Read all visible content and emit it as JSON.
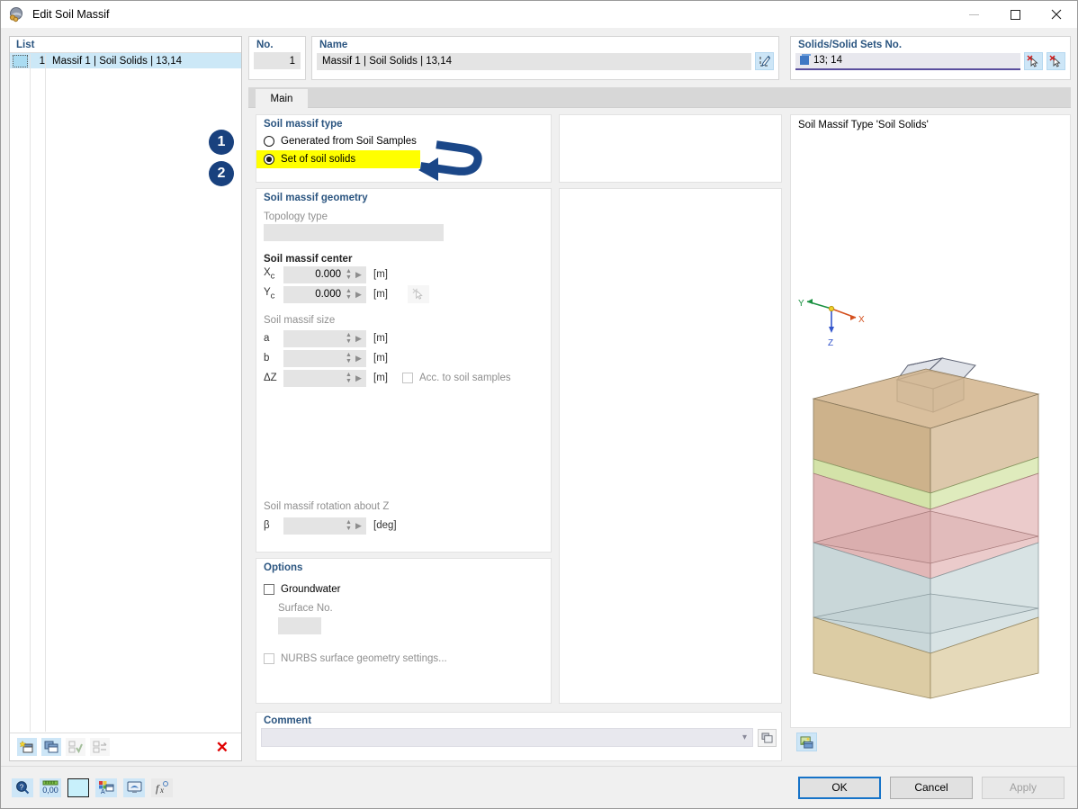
{
  "window": {
    "title": "Edit Soil Massif",
    "icon": "soil-massif-icon",
    "minimize_label": "–",
    "maximize_label": "□",
    "close_label": "✕"
  },
  "list_panel": {
    "header": "List",
    "rows": [
      {
        "number": "1",
        "label": "Massif 1 | Soil Solids | 13,14"
      }
    ],
    "toolbar": [
      {
        "name": "new-object-button",
        "icon": "new-window-icon",
        "enabled": true
      },
      {
        "name": "copy-object-button",
        "icon": "copy-windows-icon",
        "enabled": true
      },
      {
        "name": "select-all-button",
        "icon": "check-list-icon",
        "enabled": false
      },
      {
        "name": "invert-selection-button",
        "icon": "invert-list-icon",
        "enabled": false
      },
      {
        "name": "delete-object-button",
        "icon": "red-x-icon",
        "enabled": true
      }
    ],
    "delete_glyph": "✕"
  },
  "no_panel": {
    "label": "No.",
    "value": "1"
  },
  "name_panel": {
    "label": "Name",
    "value": "Massif 1 | Soil Solids | 13,14",
    "edit_button_icon": "edit-pencil-icon"
  },
  "solids_panel": {
    "label": "Solids/Solid Sets No.",
    "value": "13; 14",
    "value_icon": "solid-cube-icon",
    "buttons": [
      {
        "name": "pick-solids-button",
        "icon": "pick-cursor-icon"
      },
      {
        "name": "deselect-solids-button",
        "icon": "pick-cursor-icon"
      }
    ]
  },
  "tabs": [
    {
      "label": "Main",
      "active": true
    }
  ],
  "soil_massif_type": {
    "title": "Soil massif type",
    "options": [
      {
        "label": "Generated from Soil Samples",
        "selected": false,
        "highlighted": false
      },
      {
        "label": "Set of soil solids",
        "selected": true,
        "highlighted": true
      }
    ]
  },
  "soil_massif_geometry": {
    "title": "Soil massif geometry",
    "topology_label": "Topology type",
    "topology_value": "",
    "center_label": "Soil massif center",
    "center_fields": [
      {
        "symbol": "X",
        "sub": "c",
        "value": "0.000",
        "unit": "[m]"
      },
      {
        "symbol": "Y",
        "sub": "c",
        "value": "0.000",
        "unit": "[m]"
      }
    ],
    "center_pick_button": "pick-point-icon",
    "size_label": "Soil massif size",
    "size_fields": [
      {
        "symbol": "a",
        "value": "",
        "unit": "[m]"
      },
      {
        "symbol": "b",
        "value": "",
        "unit": "[m]"
      },
      {
        "symbol": "ΔZ",
        "value": "",
        "unit": "[m]"
      }
    ],
    "acc_checkbox": {
      "label": "Acc. to soil samples",
      "checked": false
    },
    "rotation_label": "Soil massif rotation about Z",
    "rotation_field": {
      "symbol": "β",
      "value": "",
      "unit": "[deg]"
    }
  },
  "options": {
    "title": "Options",
    "groundwater": {
      "label": "Groundwater",
      "checked": false
    },
    "surface_label": "Surface No.",
    "surface_value": "",
    "nurbs": {
      "label": "NURBS surface geometry settings...",
      "checked": false
    }
  },
  "comment": {
    "title": "Comment",
    "value": "",
    "dropdown_icon": "chevron-down-icon",
    "copy_button_icon": "copy-windows-icon"
  },
  "visualization": {
    "title": "Soil Massif Type 'Soil Solids'",
    "axes": [
      {
        "label": "X",
        "color": "#d4501e"
      },
      {
        "label": "Y",
        "color": "#1a9141"
      },
      {
        "label": "Z",
        "color": "#3355cc"
      }
    ],
    "layers": [
      {
        "name": "topsoil",
        "color": "#d2b48c"
      },
      {
        "name": "green-layer",
        "color": "#cfe0a0"
      },
      {
        "name": "clay-layer",
        "color": "#dcaaaa"
      },
      {
        "name": "silt-layer",
        "color": "#bfd0d2"
      },
      {
        "name": "sand-layer",
        "color": "#d8c69a"
      }
    ],
    "building_label": "building-wireframe",
    "render_button_icon": "render-image-icon"
  },
  "bottom_toolbar": [
    {
      "name": "help-button",
      "icon": "help-magnifier-icon"
    },
    {
      "name": "units-button",
      "icon": "units-000-icon"
    },
    {
      "name": "color-button",
      "icon": "color-swatch-icon"
    },
    {
      "name": "display-properties-button",
      "icon": "display-props-icon"
    },
    {
      "name": "view-button",
      "icon": "view-monitor-icon"
    },
    {
      "name": "formula-button",
      "icon": "formula-fx-icon"
    }
  ],
  "dialog_buttons": [
    {
      "label": "OK",
      "name": "ok-button",
      "default": true,
      "enabled": true
    },
    {
      "label": "Cancel",
      "name": "cancel-button",
      "default": false,
      "enabled": true
    },
    {
      "label": "Apply",
      "name": "apply-button",
      "default": false,
      "enabled": false
    }
  ],
  "annotations": {
    "badges": [
      {
        "text": "1",
        "color": "#19417e"
      },
      {
        "text": "2",
        "color": "#19417e"
      }
    ],
    "arrow_color": "#1b4788"
  }
}
